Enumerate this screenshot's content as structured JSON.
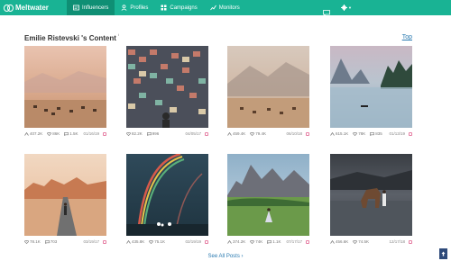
{
  "app": {
    "brand": "Meltwater"
  },
  "nav": {
    "items": [
      {
        "label": "Influencers",
        "active": true
      },
      {
        "label": "Profiles",
        "active": false
      },
      {
        "label": "Campaigns",
        "active": false
      },
      {
        "label": "Monitors",
        "active": false
      }
    ]
  },
  "page": {
    "title": "Emilie Ristevski 's Content",
    "info_mark": "i",
    "top_link": "Top",
    "see_all": "See All Posts"
  },
  "posts": [
    {
      "reach": "407.2K",
      "likes": "86K",
      "comments": "1.5K",
      "date": "01/16/19"
    },
    {
      "reach": "",
      "likes": "82.2K",
      "comments": "996",
      "date": "04/05/17"
    },
    {
      "reach": "459.4K",
      "likes": "79.4K",
      "comments": "",
      "date": "06/10/18"
    },
    {
      "reach": "615.1K",
      "likes": "78K",
      "comments": "835",
      "date": "01/13/19"
    },
    {
      "reach": "",
      "likes": "78.1K",
      "comments": "703",
      "date": "03/19/17"
    },
    {
      "reach": "435.8K",
      "likes": "75.1K",
      "comments": "",
      "date": "02/19/19"
    },
    {
      "reach": "374.2K",
      "likes": "74K",
      "comments": "1.1K",
      "date": "07/17/17"
    },
    {
      "reach": "456.6K",
      "likes": "74.5K",
      "comments": "",
      "date": "12/17/18"
    }
  ],
  "icons": {
    "logo": "meltwater-logo-icon",
    "chat": "chat-bubble-icon",
    "settings": "gear-icon",
    "reach": "reach-icon",
    "likes": "heart-icon",
    "comments": "comment-icon",
    "platform": "instagram-icon",
    "scroll_top": "arrow-up-icon"
  },
  "colors": {
    "brand": "#19b394",
    "brand_active": "#0f8f74",
    "link": "#2a7ab0",
    "instagram": "#e67ea3"
  }
}
